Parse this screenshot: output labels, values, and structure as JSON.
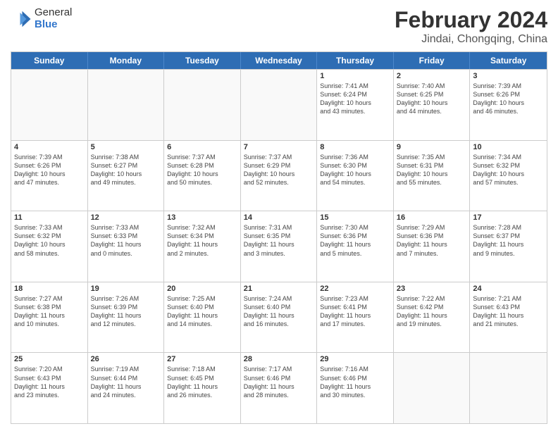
{
  "header": {
    "logo": {
      "general": "General",
      "blue": "Blue"
    },
    "title": "February 2024",
    "location": "Jindai, Chongqing, China"
  },
  "days_of_week": [
    "Sunday",
    "Monday",
    "Tuesday",
    "Wednesday",
    "Thursday",
    "Friday",
    "Saturday"
  ],
  "weeks": [
    [
      {
        "day": "",
        "info": ""
      },
      {
        "day": "",
        "info": ""
      },
      {
        "day": "",
        "info": ""
      },
      {
        "day": "",
        "info": ""
      },
      {
        "day": "1",
        "info": "Sunrise: 7:41 AM\nSunset: 6:24 PM\nDaylight: 10 hours\nand 43 minutes."
      },
      {
        "day": "2",
        "info": "Sunrise: 7:40 AM\nSunset: 6:25 PM\nDaylight: 10 hours\nand 44 minutes."
      },
      {
        "day": "3",
        "info": "Sunrise: 7:39 AM\nSunset: 6:26 PM\nDaylight: 10 hours\nand 46 minutes."
      }
    ],
    [
      {
        "day": "4",
        "info": "Sunrise: 7:39 AM\nSunset: 6:26 PM\nDaylight: 10 hours\nand 47 minutes."
      },
      {
        "day": "5",
        "info": "Sunrise: 7:38 AM\nSunset: 6:27 PM\nDaylight: 10 hours\nand 49 minutes."
      },
      {
        "day": "6",
        "info": "Sunrise: 7:37 AM\nSunset: 6:28 PM\nDaylight: 10 hours\nand 50 minutes."
      },
      {
        "day": "7",
        "info": "Sunrise: 7:37 AM\nSunset: 6:29 PM\nDaylight: 10 hours\nand 52 minutes."
      },
      {
        "day": "8",
        "info": "Sunrise: 7:36 AM\nSunset: 6:30 PM\nDaylight: 10 hours\nand 54 minutes."
      },
      {
        "day": "9",
        "info": "Sunrise: 7:35 AM\nSunset: 6:31 PM\nDaylight: 10 hours\nand 55 minutes."
      },
      {
        "day": "10",
        "info": "Sunrise: 7:34 AM\nSunset: 6:32 PM\nDaylight: 10 hours\nand 57 minutes."
      }
    ],
    [
      {
        "day": "11",
        "info": "Sunrise: 7:33 AM\nSunset: 6:32 PM\nDaylight: 10 hours\nand 58 minutes."
      },
      {
        "day": "12",
        "info": "Sunrise: 7:33 AM\nSunset: 6:33 PM\nDaylight: 11 hours\nand 0 minutes."
      },
      {
        "day": "13",
        "info": "Sunrise: 7:32 AM\nSunset: 6:34 PM\nDaylight: 11 hours\nand 2 minutes."
      },
      {
        "day": "14",
        "info": "Sunrise: 7:31 AM\nSunset: 6:35 PM\nDaylight: 11 hours\nand 3 minutes."
      },
      {
        "day": "15",
        "info": "Sunrise: 7:30 AM\nSunset: 6:36 PM\nDaylight: 11 hours\nand 5 minutes."
      },
      {
        "day": "16",
        "info": "Sunrise: 7:29 AM\nSunset: 6:36 PM\nDaylight: 11 hours\nand 7 minutes."
      },
      {
        "day": "17",
        "info": "Sunrise: 7:28 AM\nSunset: 6:37 PM\nDaylight: 11 hours\nand 9 minutes."
      }
    ],
    [
      {
        "day": "18",
        "info": "Sunrise: 7:27 AM\nSunset: 6:38 PM\nDaylight: 11 hours\nand 10 minutes."
      },
      {
        "day": "19",
        "info": "Sunrise: 7:26 AM\nSunset: 6:39 PM\nDaylight: 11 hours\nand 12 minutes."
      },
      {
        "day": "20",
        "info": "Sunrise: 7:25 AM\nSunset: 6:40 PM\nDaylight: 11 hours\nand 14 minutes."
      },
      {
        "day": "21",
        "info": "Sunrise: 7:24 AM\nSunset: 6:40 PM\nDaylight: 11 hours\nand 16 minutes."
      },
      {
        "day": "22",
        "info": "Sunrise: 7:23 AM\nSunset: 6:41 PM\nDaylight: 11 hours\nand 17 minutes."
      },
      {
        "day": "23",
        "info": "Sunrise: 7:22 AM\nSunset: 6:42 PM\nDaylight: 11 hours\nand 19 minutes."
      },
      {
        "day": "24",
        "info": "Sunrise: 7:21 AM\nSunset: 6:43 PM\nDaylight: 11 hours\nand 21 minutes."
      }
    ],
    [
      {
        "day": "25",
        "info": "Sunrise: 7:20 AM\nSunset: 6:43 PM\nDaylight: 11 hours\nand 23 minutes."
      },
      {
        "day": "26",
        "info": "Sunrise: 7:19 AM\nSunset: 6:44 PM\nDaylight: 11 hours\nand 24 minutes."
      },
      {
        "day": "27",
        "info": "Sunrise: 7:18 AM\nSunset: 6:45 PM\nDaylight: 11 hours\nand 26 minutes."
      },
      {
        "day": "28",
        "info": "Sunrise: 7:17 AM\nSunset: 6:46 PM\nDaylight: 11 hours\nand 28 minutes."
      },
      {
        "day": "29",
        "info": "Sunrise: 7:16 AM\nSunset: 6:46 PM\nDaylight: 11 hours\nand 30 minutes."
      },
      {
        "day": "",
        "info": ""
      },
      {
        "day": "",
        "info": ""
      }
    ]
  ]
}
